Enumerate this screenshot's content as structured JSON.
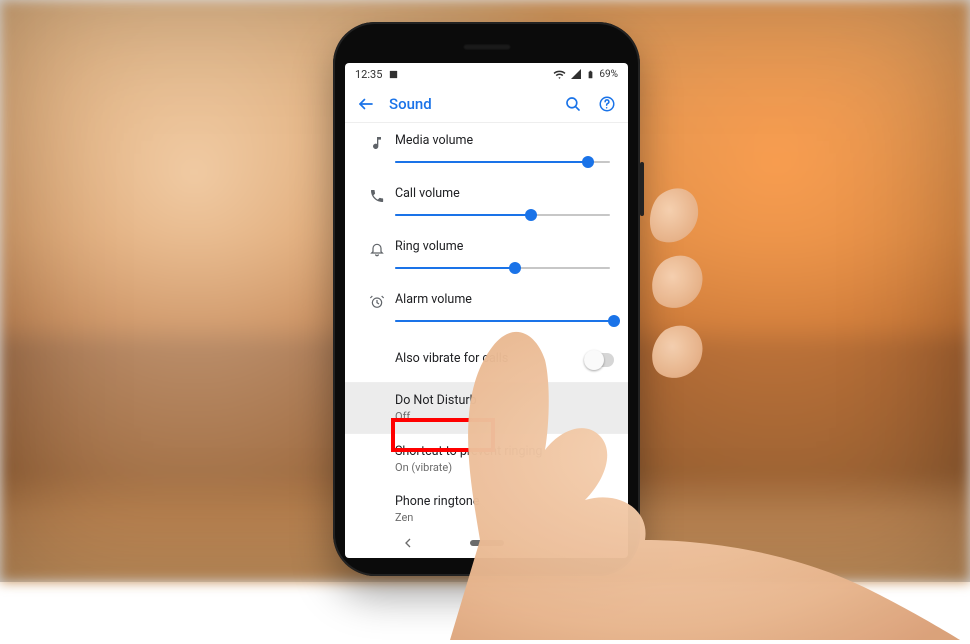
{
  "status": {
    "time": "12:35",
    "battery_text": "69%"
  },
  "appbar": {
    "title": "Sound"
  },
  "sliders": {
    "media": {
      "label": "Media volume",
      "pct": 88
    },
    "call": {
      "label": "Call volume",
      "pct": 62
    },
    "ring": {
      "label": "Ring volume",
      "pct": 55
    },
    "alarm": {
      "label": "Alarm volume",
      "pct": 100
    }
  },
  "items": {
    "vibrate": {
      "label": "Also vibrate for calls"
    },
    "dnd": {
      "label": "Do Not Disturb",
      "sub": "Off"
    },
    "shortcut": {
      "label": "Shortcut to prevent ringing",
      "sub": "On (vibrate)"
    },
    "ringtone": {
      "label": "Phone ringtone",
      "sub": "Zen"
    }
  }
}
